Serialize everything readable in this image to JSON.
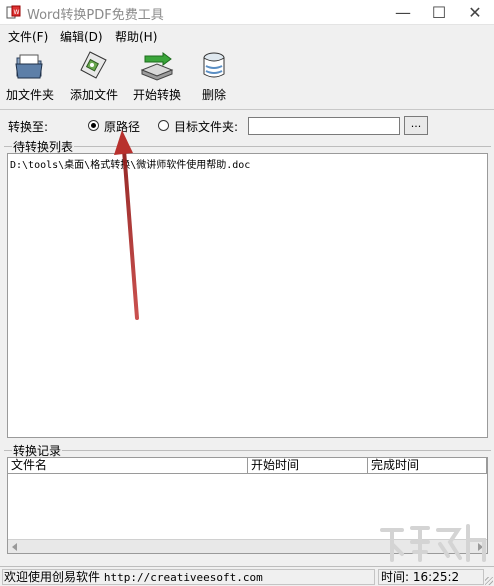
{
  "window": {
    "title": "Word转换PDF免费工具",
    "minimize": "—",
    "maximize": "☐",
    "close": "✕"
  },
  "menu": [
    "文件(F)",
    "编辑(D)",
    "帮助(H)"
  ],
  "toolbar": [
    {
      "label": "加文件夹",
      "icon": "folder-icon"
    },
    {
      "label": "添加文件",
      "icon": "add-file-icon"
    },
    {
      "label": "开始转换",
      "icon": "start-convert-icon"
    },
    {
      "label": "删除",
      "icon": "delete-icon"
    }
  ],
  "convert_to": {
    "label": "转换至:",
    "option_original": "原路径",
    "option_target": "目标文件夹:",
    "selected": "原路径",
    "target_value": "",
    "browse": "..."
  },
  "pending": {
    "title": "待转换列表",
    "items": [
      "D:\\tools\\桌面\\格式转换\\微讲师软件使用帮助.doc"
    ]
  },
  "log": {
    "title": "转换记录",
    "columns": [
      "文件名",
      "开始时间",
      "完成时间"
    ]
  },
  "status": {
    "welcome": "欢迎使用创易软件",
    "url": "http://creativeesoft.com",
    "time_label": "时间:",
    "time_value": "16:25:2"
  },
  "colors": {
    "annotation_arrow": "#c8322f",
    "window_bg": "#f0f0f0"
  }
}
